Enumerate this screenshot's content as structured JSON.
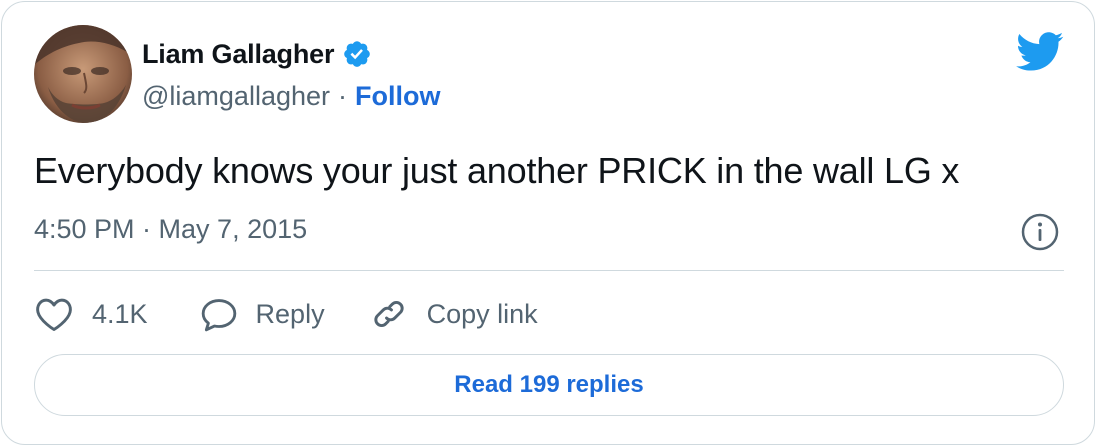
{
  "author": {
    "display_name": "Liam Gallagher",
    "handle": "@liamgallagher",
    "separator": "·",
    "follow_label": "Follow",
    "verified": true
  },
  "tweet": {
    "text": "Everybody knows your just another PRICK in the wall LG x",
    "timestamp": "4:50 PM · May 7, 2015"
  },
  "actions": {
    "like_count": "4.1K",
    "reply_label": "Reply",
    "copy_link_label": "Copy link"
  },
  "read_replies_label": "Read 199 replies",
  "colors": {
    "accent": "#1d6bd8",
    "twitter_blue": "#1d9bf0",
    "text_primary": "#0f1419",
    "text_secondary": "#536471",
    "border": "#cfd9de"
  },
  "icons": {
    "brand": "twitter-bird-icon",
    "verified": "verified-badge-icon",
    "info": "info-icon",
    "like": "heart-icon",
    "reply": "speech-bubble-icon",
    "copy_link": "link-icon"
  }
}
